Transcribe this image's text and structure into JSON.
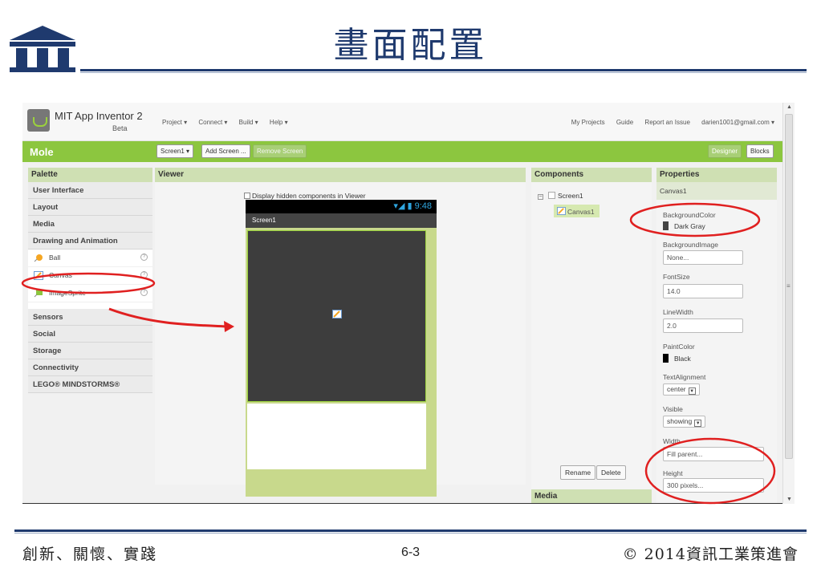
{
  "slide": {
    "title": "畫面配置",
    "footer_left": "創新、關懷、實踐",
    "footer_center": "6-3",
    "footer_right": "© 2014資訊工業策進會"
  },
  "app": {
    "name": "MIT App Inventor 2",
    "beta": "Beta",
    "menu": [
      "Project ▾",
      "Connect ▾",
      "Build ▾",
      "Help ▾"
    ],
    "right_menu": [
      "My Projects",
      "Guide",
      "Report an Issue",
      "darien1001@gmail.com ▾"
    ],
    "project": "Mole",
    "screen_select": "Screen1 ▾",
    "add_screen": "Add Screen ...",
    "remove_screen": "Remove Screen",
    "designer": "Designer",
    "blocks": "Blocks"
  },
  "palette": {
    "title": "Palette",
    "categories_top": [
      "User Interface",
      "Layout",
      "Media",
      "Drawing and Animation"
    ],
    "items": [
      {
        "label": "Ball",
        "icon": "ball-icon"
      },
      {
        "label": "Canvas",
        "icon": "canvas-icon"
      },
      {
        "label": "ImageSprite",
        "icon": "imagesprite-icon"
      }
    ],
    "categories_bottom": [
      "Sensors",
      "Social",
      "Storage",
      "Connectivity",
      "LEGO® MINDSTORMS®"
    ]
  },
  "viewer": {
    "title": "Viewer",
    "hidden_toggle": "Display hidden components in Viewer",
    "time": "9:48",
    "screen_title": "Screen1"
  },
  "components": {
    "title": "Components",
    "root": "Screen1",
    "child": "Canvas1",
    "rename": "Rename",
    "delete": "Delete",
    "media_title": "Media"
  },
  "properties": {
    "title": "Properties",
    "selected": "Canvas1",
    "background_color_label": "BackgroundColor",
    "background_color_value": "Dark Gray",
    "background_image_label": "BackgroundImage",
    "background_image_value": "None...",
    "font_size_label": "FontSize",
    "font_size_value": "14.0",
    "line_width_label": "LineWidth",
    "line_width_value": "2.0",
    "paint_color_label": "PaintColor",
    "paint_color_value": "Black",
    "text_alignment_label": "TextAlignment",
    "text_alignment_value": "center",
    "visible_label": "Visible",
    "visible_value": "showing",
    "width_label": "Width",
    "width_value": "Fill parent...",
    "height_label": "Height",
    "height_value": "300 pixels..."
  },
  "colors": {
    "accent_green": "#8cc63f",
    "title_blue": "#1f3a6e",
    "annotation_red": "#e02020",
    "dark_gray": "#444444",
    "black": "#000000"
  }
}
